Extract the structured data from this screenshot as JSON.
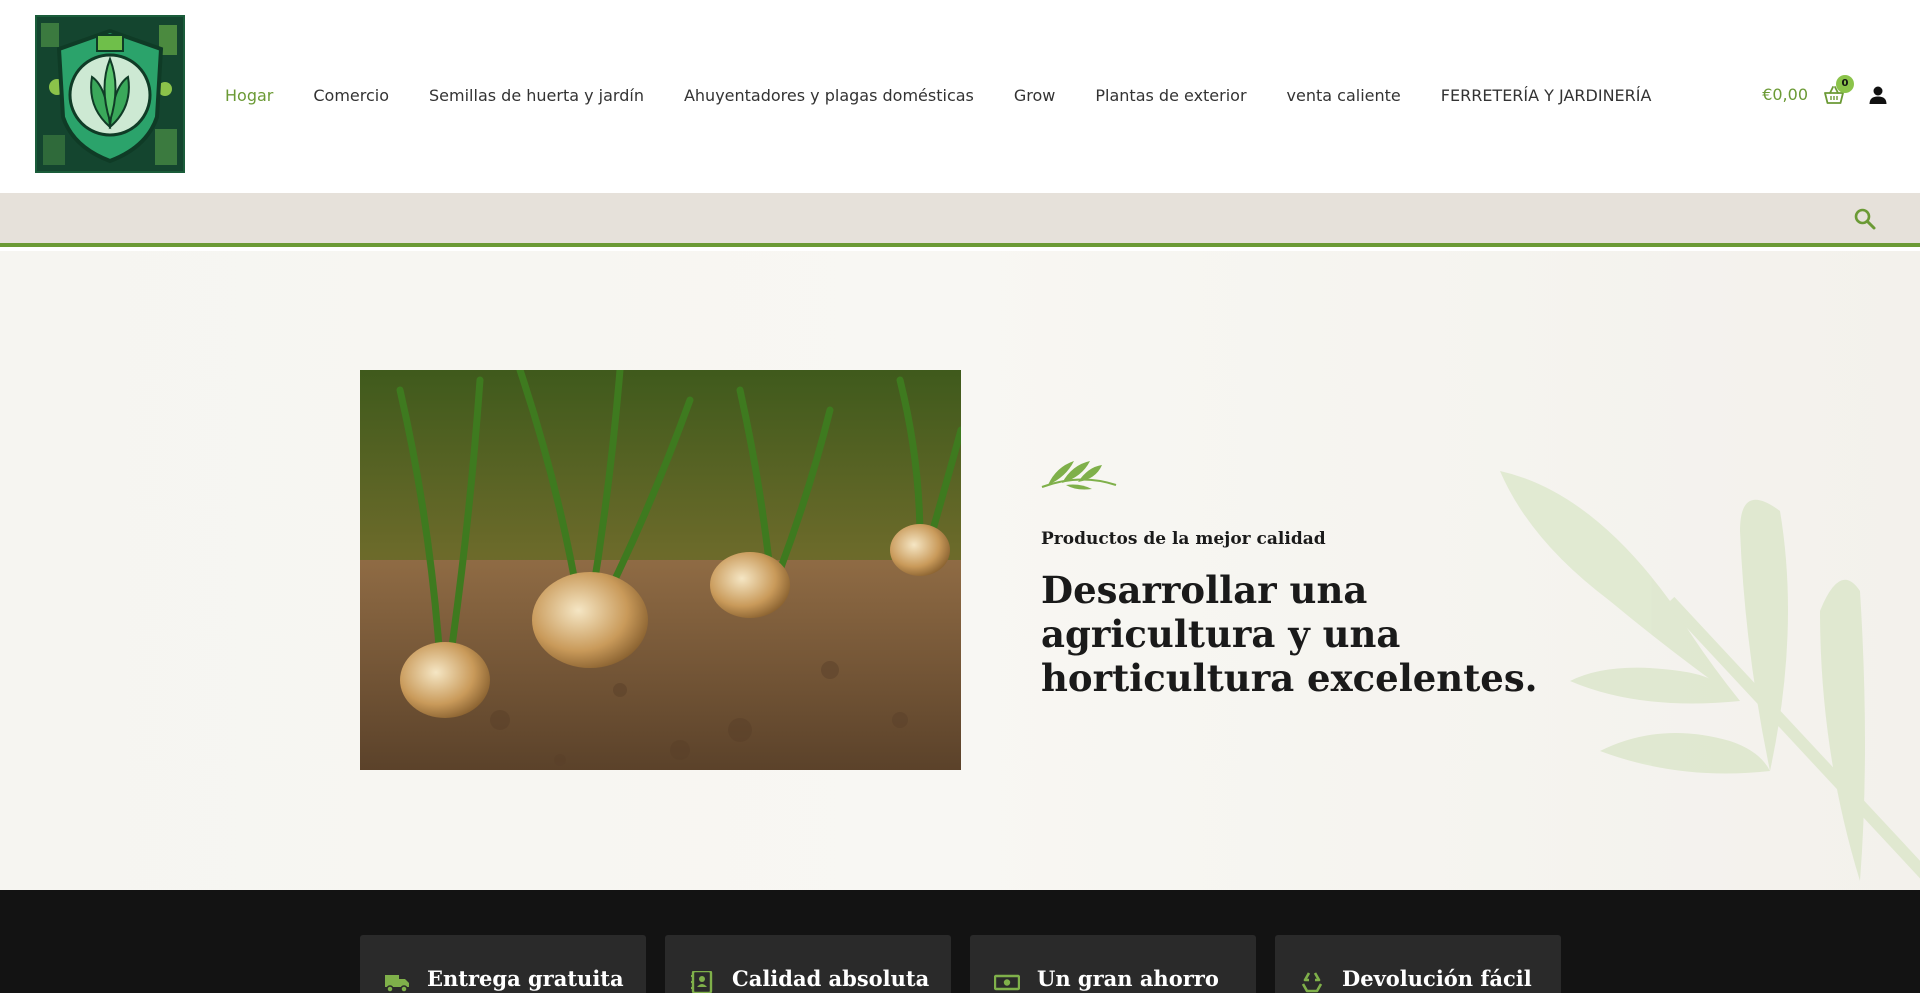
{
  "header": {
    "nav": [
      {
        "label": "Hogar",
        "active": true
      },
      {
        "label": "Comercio"
      },
      {
        "label": "Semillas de huerta y jardín"
      },
      {
        "label": "Ahuyentadores y plagas domésticas"
      },
      {
        "label": "Grow"
      },
      {
        "label": "Plantas de exterior"
      },
      {
        "label": "venta caliente"
      },
      {
        "label": "FERRETERÍA Y JARDINERÍA"
      }
    ],
    "cart_total": "€0,00",
    "cart_count": "0",
    "icons": {
      "cart": "basket-icon",
      "account": "user-icon",
      "search": "search-icon"
    }
  },
  "hero": {
    "eyebrow": "Productos de la mejor calidad",
    "title": "Desarrollar una agricultura y una horticultura excelentes."
  },
  "features": [
    {
      "label": "Entrega gratuita",
      "icon": "truck-icon"
    },
    {
      "label": "Calidad absoluta",
      "icon": "contact-book-icon"
    },
    {
      "label": "Un gran ahorro",
      "icon": "money-icon"
    },
    {
      "label": "Devolución fácil",
      "icon": "recycle-icon"
    }
  ],
  "colors": {
    "accent": "#6b9a35",
    "badge": "#8bc34a",
    "search_bar_bg": "#e6e1da",
    "feature_band_bg": "#131313",
    "feature_card_bg": "#2a2a2a"
  }
}
